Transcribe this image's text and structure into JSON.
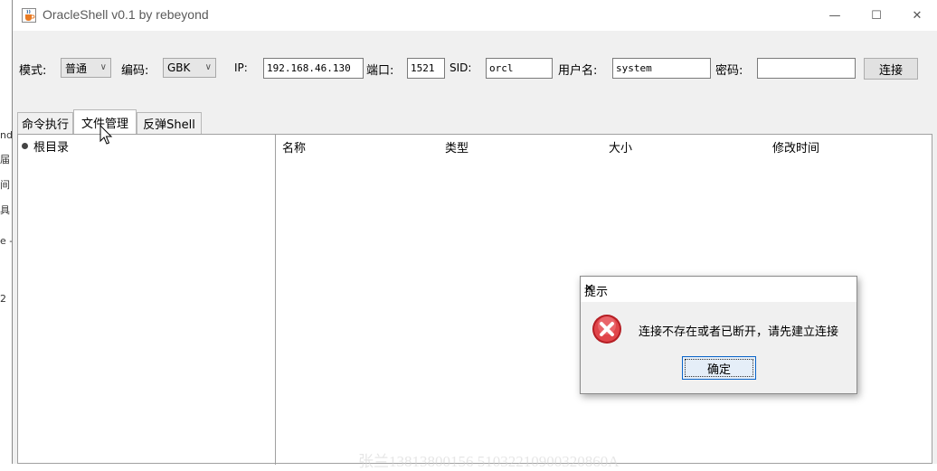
{
  "background": {
    "fragments": [
      "nd",
      "届",
      "间",
      "具",
      "e -",
      "2"
    ]
  },
  "window": {
    "title": "OracleShell v0.1  by rebeyond",
    "controls": {
      "minimize": "—",
      "maximize": "☐",
      "close": "✕"
    }
  },
  "toolbar": {
    "mode_label": "模式:",
    "mode_value": "普通",
    "encoding_label": "编码:",
    "encoding_value": "GBK",
    "ip_label": "IP:",
    "ip_value": "192.168.46.130",
    "port_label": "端口:",
    "port_value": "1521",
    "sid_label": "SID:",
    "sid_value": "orcl",
    "user_label": "用户名:",
    "user_value": "system",
    "password_label": "密码:",
    "password_value": "",
    "connect_label": "连接"
  },
  "tabs": [
    "命令执行",
    "文件管理",
    "反弹Shell"
  ],
  "active_tab": "文件管理",
  "tree": {
    "root_label": "根目录"
  },
  "table": {
    "columns": [
      "名称",
      "类型",
      "大小",
      "修改时间"
    ],
    "rows": []
  },
  "dialog": {
    "title": "提示",
    "message": "连接不存在或者已断开，请先建立连接",
    "ok_label": "确定",
    "close": "✕"
  },
  "watermark": "张兰13813800156  51032210900320860A",
  "colors": {
    "error_red": "#d9343a",
    "accent": "#0a64c8"
  }
}
